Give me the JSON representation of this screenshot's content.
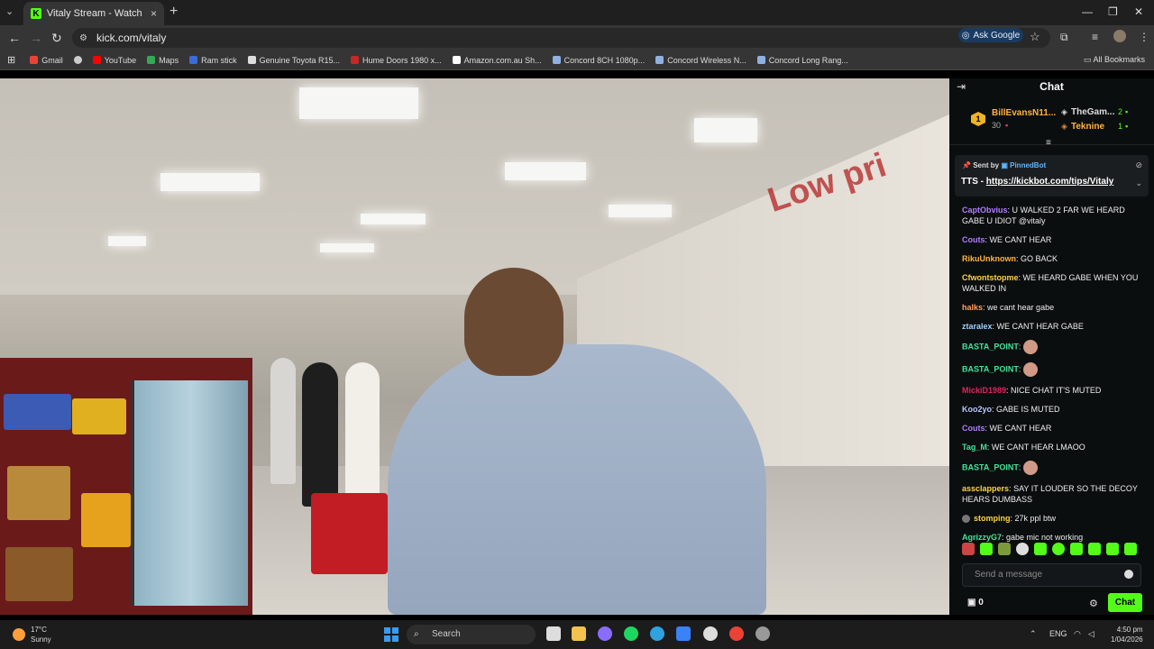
{
  "browser": {
    "tab_title": "Vitaly Stream - Watch Live on Kick",
    "new_tab_label": "+",
    "url": "kick.com/vitaly",
    "ask_google_label": "Ask Google",
    "bookmarks": [
      "Gmail",
      "YouTube",
      "Maps",
      "Ram stick",
      "Genuine Toyota R15...",
      "Hume Doors 1980 x...",
      "Amazon.com.au Sh...",
      "Concord 8CH 1080p...",
      "Concord Wireless N...",
      "Concord Long Rang..."
    ],
    "all_bookmarks_label": "All Bookmarks"
  },
  "video": {
    "sign_text": "Low pri"
  },
  "chat": {
    "title": "Chat",
    "leaderboard": {
      "first": {
        "rank": "1",
        "name": "BillEvansN11...",
        "count": "30"
      },
      "second": {
        "name": "TheGam...",
        "count": "2"
      },
      "third": {
        "name": "Teknine",
        "count": "1"
      }
    },
    "pinned": {
      "sent_by_label": "Sent by",
      "bot_name": "PinnedBot",
      "text_prefix": "TTS - ",
      "link": "https://kickbot.com/tips/Vitaly"
    },
    "messages": [
      {
        "user": "CaptObvius",
        "color": "#b07cff",
        "text": "U WALKED 2 FAR WE HEARD GABE U IDIOT @vitaly"
      },
      {
        "user": "Couts",
        "color": "#b07cff",
        "text": "WE CANT HEAR"
      },
      {
        "user": "RikuUnknown",
        "color": "#ffb347",
        "text": "GO BACK"
      },
      {
        "user": "Cfwontstopme",
        "color": "#ffd24a",
        "text": "WE HEARD GABE WHEN YOU WALKED IN"
      },
      {
        "user": "halks",
        "color": "#ff9f5a",
        "text": "we cant hear gabe"
      },
      {
        "user": "ztaralex",
        "color": "#9fd0ff",
        "text": "WE CANT HEAR GABE"
      },
      {
        "user": "BASTA_POINT",
        "color": "#42e39a",
        "text": "",
        "emote": true
      },
      {
        "user": "BASTA_POINT",
        "color": "#42e39a",
        "text": "",
        "emote": true
      },
      {
        "user": "MickiD1989",
        "color": "#e0245e",
        "text": "NICE CHAT IT'S MUTED"
      },
      {
        "user": "Koo2yo",
        "color": "#b9c6ff",
        "text": "GABE IS MUTED"
      },
      {
        "user": "Couts",
        "color": "#b07cff",
        "text": "WE CANT HEAR"
      },
      {
        "user": "Tag_M",
        "color": "#42e39a",
        "text": "WE CANT HEAR LMAOO"
      },
      {
        "user": "BASTA_POINT",
        "color": "#42e39a",
        "text": "",
        "emote": true
      },
      {
        "user": "assclappers",
        "color": "#ffd24a",
        "text": "SAY IT LOUDER SO THE DECOY HEARS DUMBASS"
      },
      {
        "user": "stomping",
        "color": "#ffd24a",
        "text": "27k ppl btw",
        "badge": true
      },
      {
        "user": "AgrizzyG7",
        "color": "#42e39a",
        "text": "gabe mic not working"
      }
    ],
    "input_placeholder": "Send a message",
    "wallet_count": "0",
    "send_label": "Chat"
  },
  "taskbar": {
    "temperature": "17°C",
    "weather": "Sunny",
    "search_label": "Search",
    "lang": "ENG",
    "time": "4:50 pm",
    "date": "1/04/2026"
  }
}
